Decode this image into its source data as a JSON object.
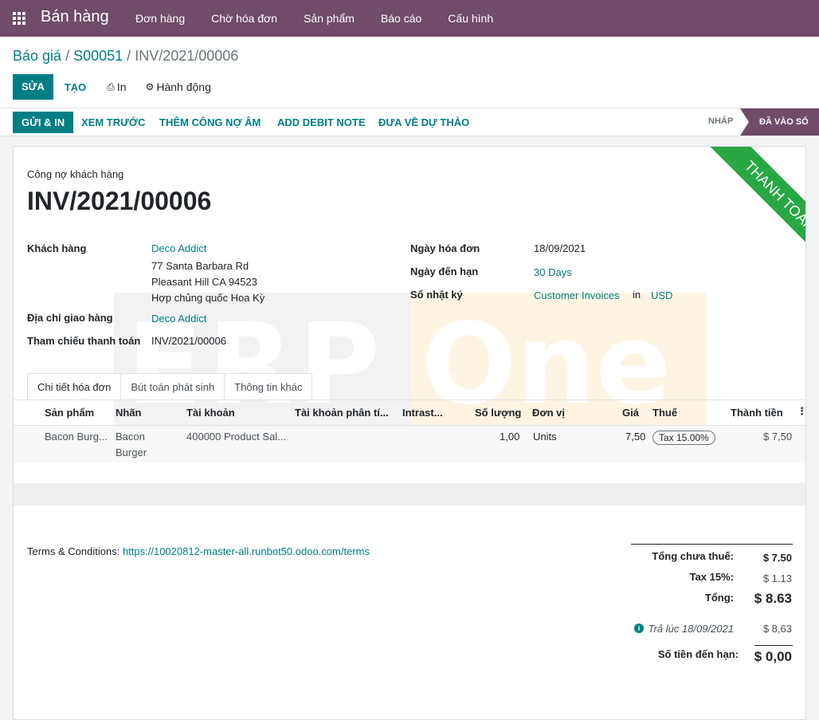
{
  "navbar": {
    "app_name": "Bán hàng",
    "menu": [
      "Đơn hàng",
      "Chờ hóa đơn",
      "Sản phẩm",
      "Báo cáo",
      "Cấu hình"
    ]
  },
  "breadcrumb": {
    "items": [
      "Báo giá",
      "S00051"
    ],
    "current": "INV/2021/00006"
  },
  "controls": {
    "edit": "SỬA",
    "create": "TẠO",
    "print": "In",
    "action": "Hành động"
  },
  "statusbar": {
    "buttons": [
      "GỬI & IN",
      "XEM TRƯỚC",
      "THÊM CÔNG NỢ ÂM",
      "ADD DEBIT NOTE",
      "ĐƯA VỀ DỰ THẢO"
    ],
    "stages": [
      "NHÁP",
      "ĐÃ VÀO SỔ"
    ]
  },
  "sheet": {
    "ribbon": "THANH TOÁN",
    "subtitle": "Công nợ khách hàng",
    "title": "INV/2021/00006",
    "watermark": [
      "ERP",
      "One"
    ],
    "customer_label": "Khách hàng",
    "customer": "Deco Addict",
    "address": [
      "77 Santa Barbara Rd",
      "Pleasant Hill CA 94523",
      "Hợp chủng quốc Hoa Kỳ"
    ],
    "delivery_label": "Địa chỉ giao hàng",
    "delivery": "Deco Addict",
    "payment_ref_label": "Tham chiếu thanh toán",
    "payment_ref": "INV/2021/00006",
    "invoice_date_label": "Ngày hóa đơn",
    "invoice_date": "18/09/2021",
    "due_date_label": "Ngày đến hạn",
    "due_date": "30 Days",
    "journal_label": "Sổ nhật ký",
    "journal": "Customer Invoices",
    "journal_in": "in",
    "currency": "USD"
  },
  "tabs": [
    "Chi tiết hóa đơn",
    "Bút toán phát sinh",
    "Thông tin khác"
  ],
  "table": {
    "headers": [
      "Sản phẩm",
      "Nhãn",
      "Tài khoản",
      "Tài khoản phân tí...",
      "Intrast...",
      "Số lượng",
      "Đơn vị",
      "Giá",
      "Thuế",
      "Thành tiền"
    ],
    "row": {
      "product": "Bacon Burg...",
      "label1": "Bacon",
      "label2": "Burger",
      "account": "400000 Product Sal...",
      "qty": "1,00",
      "uom": "Units",
      "price": "7,50",
      "tax": "Tax 15.00%",
      "subtotal": "$ 7,50"
    }
  },
  "terms": {
    "label": "Terms & Conditions:",
    "url": "https://10020812-master-all.runbot50.odoo.com/terms"
  },
  "totals": {
    "untaxed_label": "Tổng chưa thuế:",
    "untaxed": "$ 7.50",
    "tax_label": "Tax 15%:",
    "tax": "$ 1.13",
    "total_label": "Tổng:",
    "total": "$ 8.63",
    "paid_label": "Trả lúc 18/09/2021",
    "paid": "$ 8,63",
    "due_label": "Số tiền đến hạn:",
    "due": "$ 0,00"
  }
}
